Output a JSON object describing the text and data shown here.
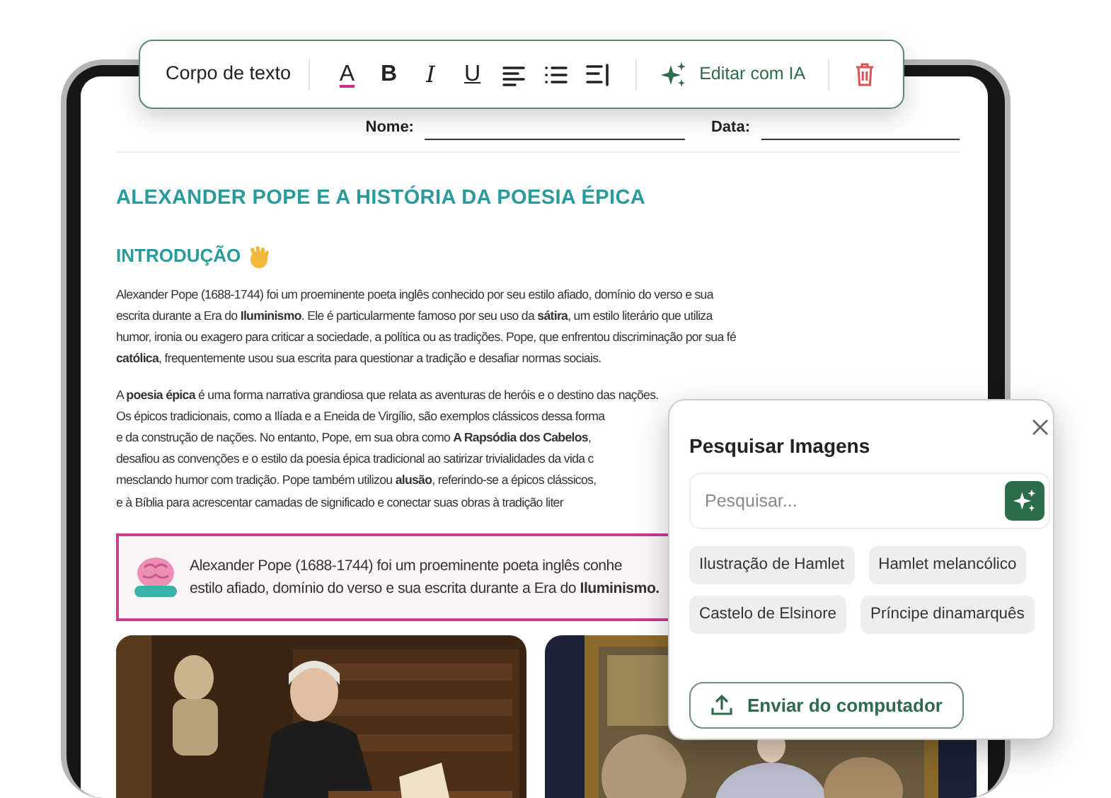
{
  "toolbar": {
    "style_label": "Corpo de texto",
    "format_buttons": [
      {
        "kind": "color",
        "label": "A"
      },
      {
        "kind": "bold",
        "label": "B"
      },
      {
        "kind": "italic",
        "label": "I"
      },
      {
        "kind": "underline",
        "label": "U"
      },
      {
        "kind": "align"
      },
      {
        "kind": "list"
      },
      {
        "kind": "more"
      }
    ],
    "ai_button": "Editar com IA"
  },
  "header_fields": [
    {
      "label": "Nome:"
    },
    {
      "label": "Data:"
    }
  ],
  "title": "ALEXANDER POPE E A HISTÓRIA DA POESIA ÉPICA",
  "section_heading": "INTRODUÇÃO",
  "paragraphs": [
    {
      "lines": [
        "Alexander Pope (1688-1744) foi um proeminente poeta inglês conhecido por seu estilo afiado, domínio do verso e sua",
        "escrita durante a Era do **Iluminismo**. Ele é particularmente famoso por seu uso da **sátira**, um estilo literário que utiliza",
        "humor, ironia ou exagero para criticar a sociedade, a política ou as tradições. Pope, que enfrentou  discriminação por sua fé",
        "**católica**, frequentemente usou sua escrita para questionar a tradição e desafiar normas sociais."
      ]
    },
    {
      "lines": [
        "A **poesia épica** é uma forma narrativa grandiosa que relata as aventuras de heróis e o destino das nações.",
        "Os épicos tradicionais, como a Ilíada e a Eneida de Virgílio, são exemplos clássicos dessa forma",
        "e da construção de nações. No entanto, Pope, em sua obra como **A Rapsódia dos Cabelos**,",
        "desafiou as convenções e o estilo da poesia épica tradicional ao satirizar trivialidades da vida c",
        "mesclando humor com tradição. Pope também utilizou **alusão**, referindo-se a épicos clássicos,",
        "e à Bíblia para acrescentar camadas de significado e conectar suas  obras à tradição liter"
      ]
    }
  ],
  "callout": {
    "lines": [
      "Alexander Pope (1688-1744) foi um proeminente poeta inglês conhe",
      "estilo afiado, domínio do verso e sua escrita durante a Era do **Iluminismo.**"
    ]
  },
  "image_search": {
    "title": "Pesquisar Imagens",
    "placeholder": "Pesquisar...",
    "suggestions": [
      "Ilustração de Hamlet",
      "Hamlet melancólico",
      "Castelo de Elsinore",
      "Príncipe dinamarquês"
    ],
    "upload_button": "Enviar do computador"
  }
}
